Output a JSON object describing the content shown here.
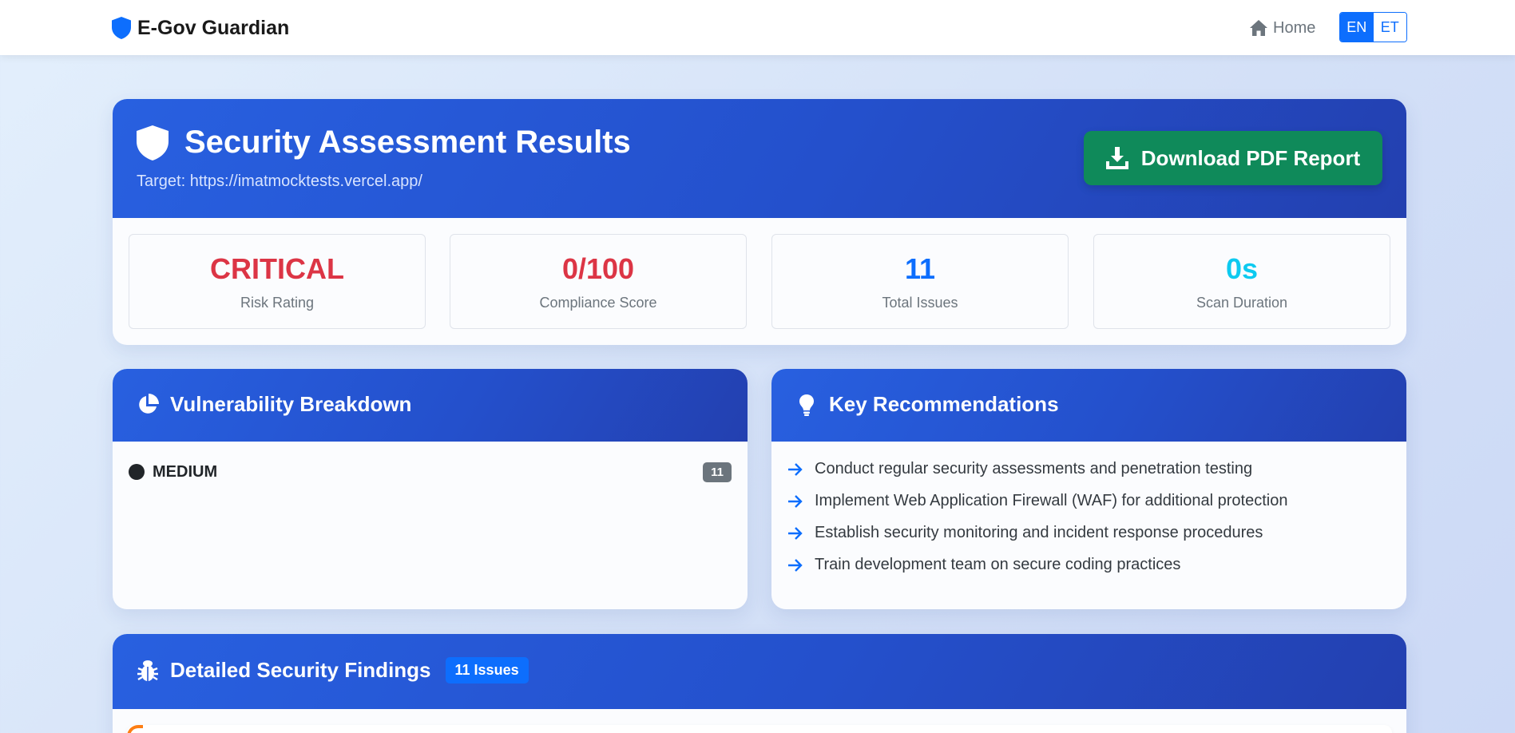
{
  "navbar": {
    "brand": "E-Gov Guardian",
    "home_label": "Home",
    "languages": [
      "EN",
      "ET"
    ],
    "active_language": "EN",
    "icons": {
      "brand": "shield-icon",
      "home": "home-icon"
    }
  },
  "results": {
    "title": "Security Assessment Results",
    "target": "Target: https://imatmocktests.vercel.app/",
    "download_label": "Download PDF Report",
    "stats": [
      {
        "value": "CRITICAL",
        "label": "Risk Rating",
        "color": "#dc3545"
      },
      {
        "value": "0/100",
        "label": "Compliance Score",
        "color": "#dc3545"
      },
      {
        "value": "11",
        "label": "Total Issues",
        "color": "#0d6efd"
      },
      {
        "value": "0s",
        "label": "Scan Duration",
        "color": "#0dcaf0"
      }
    ]
  },
  "breakdown": {
    "title": "Vulnerability Breakdown",
    "items": [
      {
        "severity": "MEDIUM",
        "count": "11"
      }
    ]
  },
  "recommendations": {
    "title": "Key Recommendations",
    "items": [
      "Conduct regular security assessments and penetration testing",
      "Implement Web Application Firewall (WAF) for additional protection",
      "Establish security monitoring and incident response procedures",
      "Train development team on secure coding practices"
    ]
  },
  "findings": {
    "title": "Detailed Security Findings",
    "badge": "11 Issues"
  },
  "colors": {
    "primary": "#0d6efd",
    "header_gradient_start": "#2860e0",
    "header_gradient_end": "#2340b0",
    "download_green": "#0f8a5a",
    "critical_red": "#dc3545",
    "info_cyan": "#0dcaf0"
  }
}
